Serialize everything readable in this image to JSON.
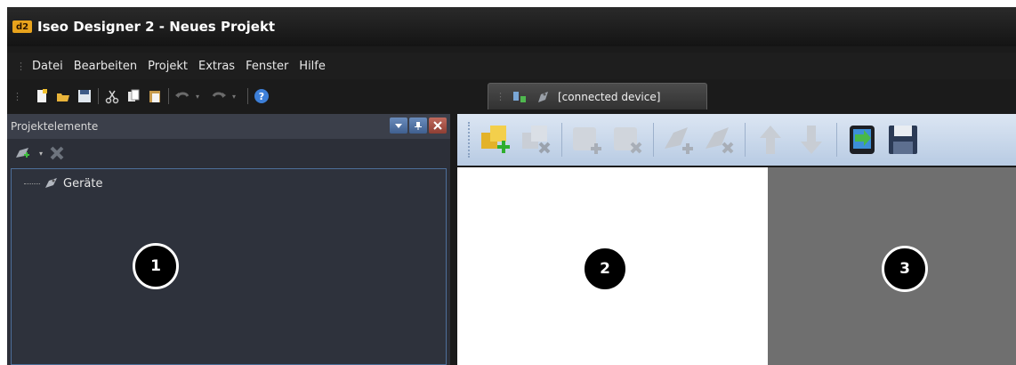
{
  "window": {
    "logo_text": "d2",
    "title": "Iseo Designer 2 - Neues Projekt"
  },
  "menu": {
    "items": [
      "Datei",
      "Bearbeiten",
      "Projekt",
      "Extras",
      "Fenster",
      "Hilfe"
    ]
  },
  "toolbar": {
    "icons": [
      "new-icon",
      "open-icon",
      "save-icon",
      "cut-icon",
      "copy-icon",
      "paste-icon",
      "undo-icon",
      "redo-icon",
      "help-icon"
    ]
  },
  "document_tab": {
    "label": "[connected device]"
  },
  "panel": {
    "title": "Projektelemente",
    "tree": [
      {
        "label": "Geräte",
        "icon": "device-icon"
      }
    ]
  },
  "device_toolbar": {
    "icons": [
      "add-element-icon",
      "remove-element-icon",
      "add-item-icon",
      "remove-item-icon",
      "add-key-icon",
      "remove-key-icon",
      "move-up-icon",
      "move-down-icon",
      "transfer-to-device-icon",
      "save-icon"
    ]
  },
  "callouts": [
    "1",
    "2",
    "3"
  ],
  "colors": {
    "title_bar": "#141414",
    "panel_bg": "#2c2f38",
    "tree_border": "#4d6f9a",
    "toolbar_blue": "#b8cbe3",
    "gray_pane": "#6f6f6f"
  }
}
